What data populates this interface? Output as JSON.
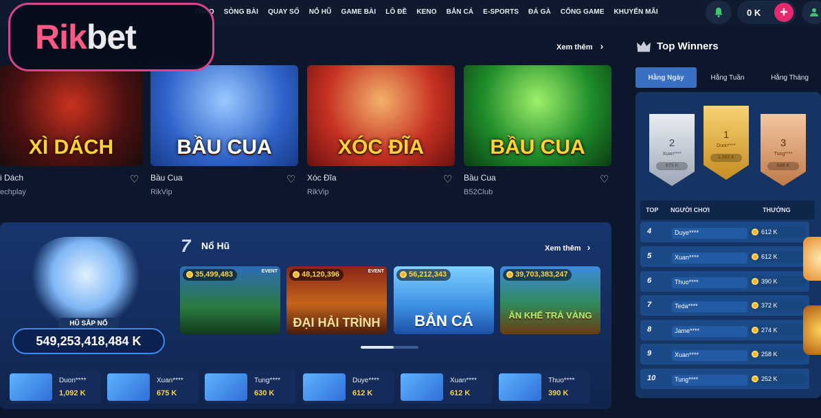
{
  "nav": {
    "items": [
      "THAO",
      "SÒNG BÀI",
      "QUAY SỐ",
      "NỔ HŨ",
      "GAME BÀI",
      "LÔ ĐỀ",
      "KENO",
      "BẮN CÁ",
      "E-SPORTS",
      "ĐÁ GÀ",
      "CỔNG GAME",
      "KHUYẾN MÃI"
    ],
    "balance": "0 K",
    "plus": "+"
  },
  "logo": {
    "part1": "Rik",
    "part2": "bet"
  },
  "games_section": {
    "see_more": "Xem thêm",
    "cards": [
      {
        "title": "XÌ DÁCH",
        "name": "i Dách",
        "provider": "echplay"
      },
      {
        "title": "BẦU CUA",
        "name": "Bầu Cua",
        "provider": "RikVip"
      },
      {
        "title": "XÓC ĐĨA",
        "name": "Xóc Đĩa",
        "provider": "RikVip"
      },
      {
        "title": "BẦU CUA",
        "name": "Bầu Cua",
        "provider": "B52Club"
      }
    ]
  },
  "jackpot": {
    "section_title": "Nổ Hũ",
    "section_number": "7",
    "see_more": "Xem thêm",
    "pot_label": "HŨ SẮP NỔ",
    "pot_value": "549,253,418,484 K",
    "games": [
      {
        "value": "35,499,483",
        "event": "EVENT",
        "title": ""
      },
      {
        "value": "48,120,396",
        "event": "EVENT",
        "title": "ĐẠI HẢI TRÌNH"
      },
      {
        "value": "56,212,343",
        "event": "",
        "title": "BẮN CÁ"
      },
      {
        "value": "39,703,383,247",
        "event": "",
        "title": "ĂN KHẾ TRẢ VÀNG"
      }
    ],
    "winners": [
      {
        "name": "Duon****",
        "amount": "1,092 K"
      },
      {
        "name": "Xuan****",
        "amount": "675 K"
      },
      {
        "name": "Tung****",
        "amount": "630 K"
      },
      {
        "name": "Duye****",
        "amount": "612 K"
      },
      {
        "name": "Xuan****",
        "amount": "612 K"
      },
      {
        "name": "Thuo****",
        "amount": "390 K"
      }
    ]
  },
  "top_winners": {
    "title": "Top Winners",
    "tabs": [
      "Hằng Ngày",
      "Hằng Tuần",
      "Hằng Tháng"
    ],
    "active_tab": 0,
    "podium": [
      {
        "rank": "2",
        "name": "Xuan****",
        "amount": "675 K"
      },
      {
        "rank": "1",
        "name": "Duon****",
        "amount": "1,092 K"
      },
      {
        "rank": "3",
        "name": "Tung****",
        "amount": "630 K"
      }
    ],
    "headers": {
      "top": "TOP",
      "player": "NGƯỜI CHƠI",
      "reward": "THƯỞNG"
    },
    "rows": [
      {
        "rank": "4",
        "name": "Duye****",
        "amount": "612 K"
      },
      {
        "rank": "5",
        "name": "Xuan****",
        "amount": "612 K"
      },
      {
        "rank": "6",
        "name": "Thuo****",
        "amount": "390 K"
      },
      {
        "rank": "7",
        "name": "Teda****",
        "amount": "372 K"
      },
      {
        "rank": "8",
        "name": "Jame****",
        "amount": "274 K"
      },
      {
        "rank": "9",
        "name": "Xuan****",
        "amount": "258 K"
      },
      {
        "rank": "10",
        "name": "Tung****",
        "amount": "252 K"
      }
    ]
  },
  "colors": {
    "accent": "#e6296c",
    "tab_active": "#3a70c4",
    "gold": "#f7d24b",
    "logo_border": "#d5468f"
  }
}
